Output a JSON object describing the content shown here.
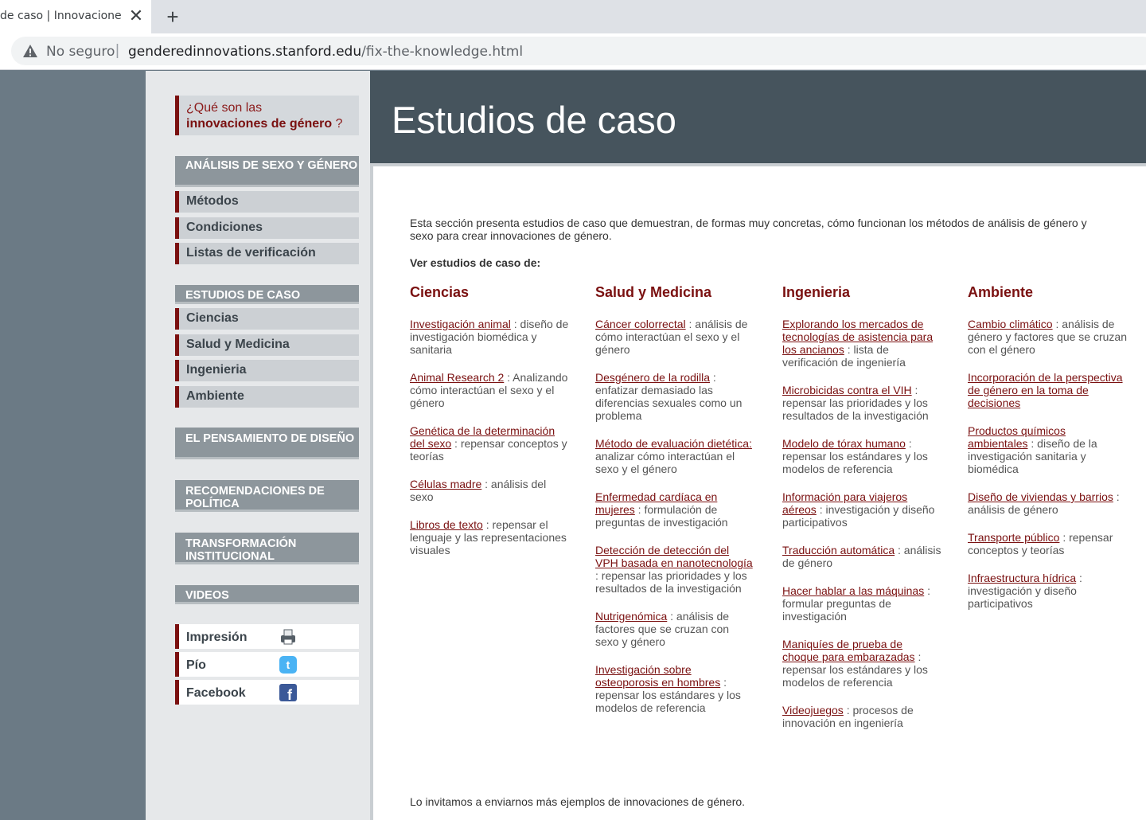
{
  "browser": {
    "tab_title": "de caso | Innovaciones de género",
    "tab_close": "✕",
    "new_tab": "+",
    "security_label": "No seguro",
    "url_separator": "|",
    "url_domain": "genderedinnovations.stanford.edu",
    "url_path": "/fix-the-knowledge.html"
  },
  "banner": {
    "title": "Estudios de caso"
  },
  "sidebar": {
    "what_line1": "¿Qué son las",
    "what_bold": "innovaciones de género",
    "what_q": " ?",
    "analysis_head": "ANÁLISIS DE SEXO Y GÉNERO",
    "analysis_items": [
      "Métodos",
      "Condiciones",
      "Listas de verificación"
    ],
    "cases_head": "ESTUDIOS DE CASO",
    "cases_items": [
      "Ciencias",
      "Salud y Medicina",
      "Ingenieria",
      "Ambiente"
    ],
    "design_head": "EL PENSAMIENTO DE DISEÑO",
    "policy_head": "RECOMENDACIONES DE POLÍTICA",
    "institutional_head": "TRANSFORMACIÓN INSTITUCIONAL",
    "videos_head": "VIDEOS",
    "share": [
      "Impresión",
      "Pío",
      "Facebook"
    ]
  },
  "main": {
    "intro": "Esta sección presenta estudios de caso que demuestran, de formas muy concretas, cómo funcionan los métodos de análisis de género y sexo para crear innovaciones de género.",
    "see_label": "Ver estudios de caso de:",
    "footer_note": "Lo invitamos a enviarnos más ejemplos de innovaciones de género.",
    "columns": [
      {
        "title": "Ciencias",
        "items": [
          {
            "link": "Investigación animal",
            "desc": " : diseño de investigación biomédica y sanitaria"
          },
          {
            "link": "Animal Research 2",
            "desc": " : Analizando cómo interactúan el sexo y el género"
          },
          {
            "link": "Genética de la determinación del sexo",
            "desc": " : repensar conceptos y teorías"
          },
          {
            "link": "Células madre",
            "desc": " : análisis del sexo"
          },
          {
            "link": "Libros de texto",
            "desc": " : repensar el lenguaje y las representaciones visuales"
          }
        ]
      },
      {
        "title": "Salud y Medicina",
        "items": [
          {
            "link": "Cáncer colorrectal",
            "desc": " : análisis de cómo interactúan el sexo y el género"
          },
          {
            "link": "Desgénero de la rodilla",
            "desc": " : enfatizar demasiado las diferencias sexuales como un problema"
          },
          {
            "link": "Método de evaluación dietética:",
            "desc": " analizar cómo interactúan el sexo y el género"
          },
          {
            "link": "Enfermedad cardíaca en mujeres",
            "desc": " : formulación de preguntas de investigación"
          },
          {
            "link": "Detección de detección del VPH basada en nanotecnología",
            "desc": " : repensar las prioridades y los resultados de la investigación"
          },
          {
            "link": "Nutrigenómica",
            "desc": " : análisis de factores que se cruzan con sexo y género"
          },
          {
            "link": "Investigación sobre osteoporosis en hombres",
            "desc": " : repensar los estándares y los modelos de referencia"
          }
        ]
      },
      {
        "title": "Ingenieria",
        "items": [
          {
            "link": "Explorando los mercados de tecnologías de asistencia para los ancianos",
            "desc": " : lista de verificación de ingeniería"
          },
          {
            "link": "Microbicidas contra el VIH",
            "desc": " : repensar las prioridades y los resultados de la investigación"
          },
          {
            "link": "Modelo de tórax humano",
            "desc": " : repensar los estándares y los modelos de referencia"
          },
          {
            "link": "Información para viajeros aéreos",
            "desc": " : investigación y diseño participativos"
          },
          {
            "link": "Traducción automática",
            "desc": " : análisis de género"
          },
          {
            "link": "Hacer hablar a las máquinas",
            "desc": " : formular preguntas de investigación"
          },
          {
            "link": "Maniquíes de prueba de choque para embarazadas",
            "desc": " : repensar los estándares y los modelos de referencia"
          },
          {
            "link": "Videojuegos",
            "desc": " : procesos de innovación en ingeniería"
          }
        ]
      },
      {
        "title": "Ambiente",
        "items": [
          {
            "link": "Cambio climático",
            "desc": " : análisis de género y factores que se cruzan con el género"
          },
          {
            "link": "Incorporación de la perspectiva de género en la toma de decisiones",
            "desc": ""
          },
          {
            "link": "Productos químicos ambientales",
            "desc": " : diseño de la investigación sanitaria y biomédica"
          },
          {
            "link": "Diseño de viviendas y barrios",
            "desc": " : análisis de género"
          },
          {
            "link": "Transporte público",
            "desc": " : repensar conceptos y teorías"
          },
          {
            "link": "Infraestructura hídrica",
            "desc": " : investigación y diseño participativos"
          }
        ]
      }
    ]
  },
  "colors": {
    "accent": "#7a1010",
    "banner": "#46545d",
    "sidebar_head": "#8d969c"
  }
}
